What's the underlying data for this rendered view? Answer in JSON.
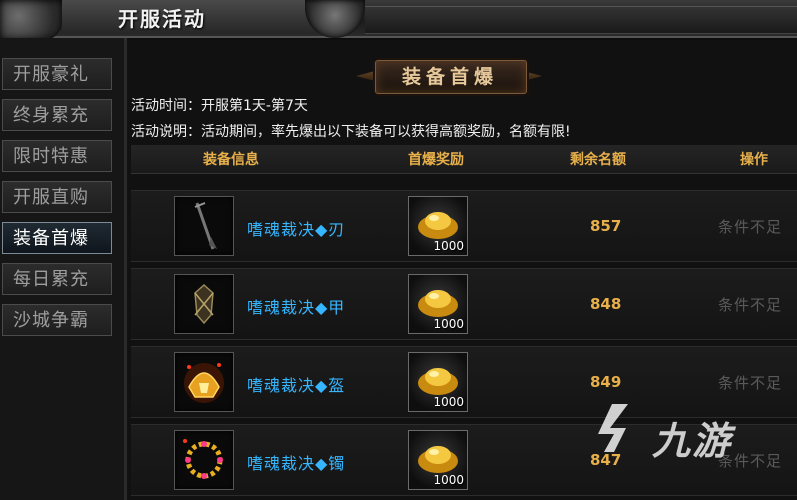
{
  "window": {
    "title": "开服活动"
  },
  "sidebar": {
    "items": [
      {
        "label": "开服豪礼",
        "active": false
      },
      {
        "label": "终身累充",
        "active": false
      },
      {
        "label": "限时特惠",
        "active": false
      },
      {
        "label": "开服直购",
        "active": false
      },
      {
        "label": "装备首爆",
        "active": true
      },
      {
        "label": "每日累充",
        "active": false
      },
      {
        "label": "沙城争霸",
        "active": false
      }
    ]
  },
  "panel": {
    "banner": "装备首爆",
    "time_line": "活动时间：开服第1天-第7天",
    "desc_line": "活动说明：活动期间，率先爆出以下装备可以获得高额奖励，名额有限!",
    "columns": {
      "item": "装备信息",
      "reward": "首爆奖励",
      "remaining": "剩余名额",
      "action": "操作"
    },
    "rows": [
      {
        "icon": "sword-icon",
        "name": "嗜魂裁决◆刃",
        "reward_amount": "1000",
        "reward_icon": "gold-ingot-icon",
        "remaining": "857",
        "action": "条件不足"
      },
      {
        "icon": "armor-icon",
        "name": "嗜魂裁决◆甲",
        "reward_amount": "1000",
        "reward_icon": "gold-ingot-icon",
        "remaining": "848",
        "action": "条件不足"
      },
      {
        "icon": "helmet-icon",
        "name": "嗜魂裁决◆盔",
        "reward_amount": "1000",
        "reward_icon": "gold-ingot-icon",
        "remaining": "849",
        "action": "条件不足"
      },
      {
        "icon": "bracelet-icon",
        "name": "嗜魂裁决◆镯",
        "reward_amount": "1000",
        "reward_icon": "gold-ingot-icon",
        "remaining": "847",
        "action": "条件不足"
      }
    ]
  },
  "watermark": {
    "text": "九游",
    "icon": "9game-logo-icon"
  },
  "colors": {
    "accent_gold": "#e8b04a",
    "item_name_blue": "#35b6ff",
    "disabled_gray": "#5a5a5a"
  }
}
